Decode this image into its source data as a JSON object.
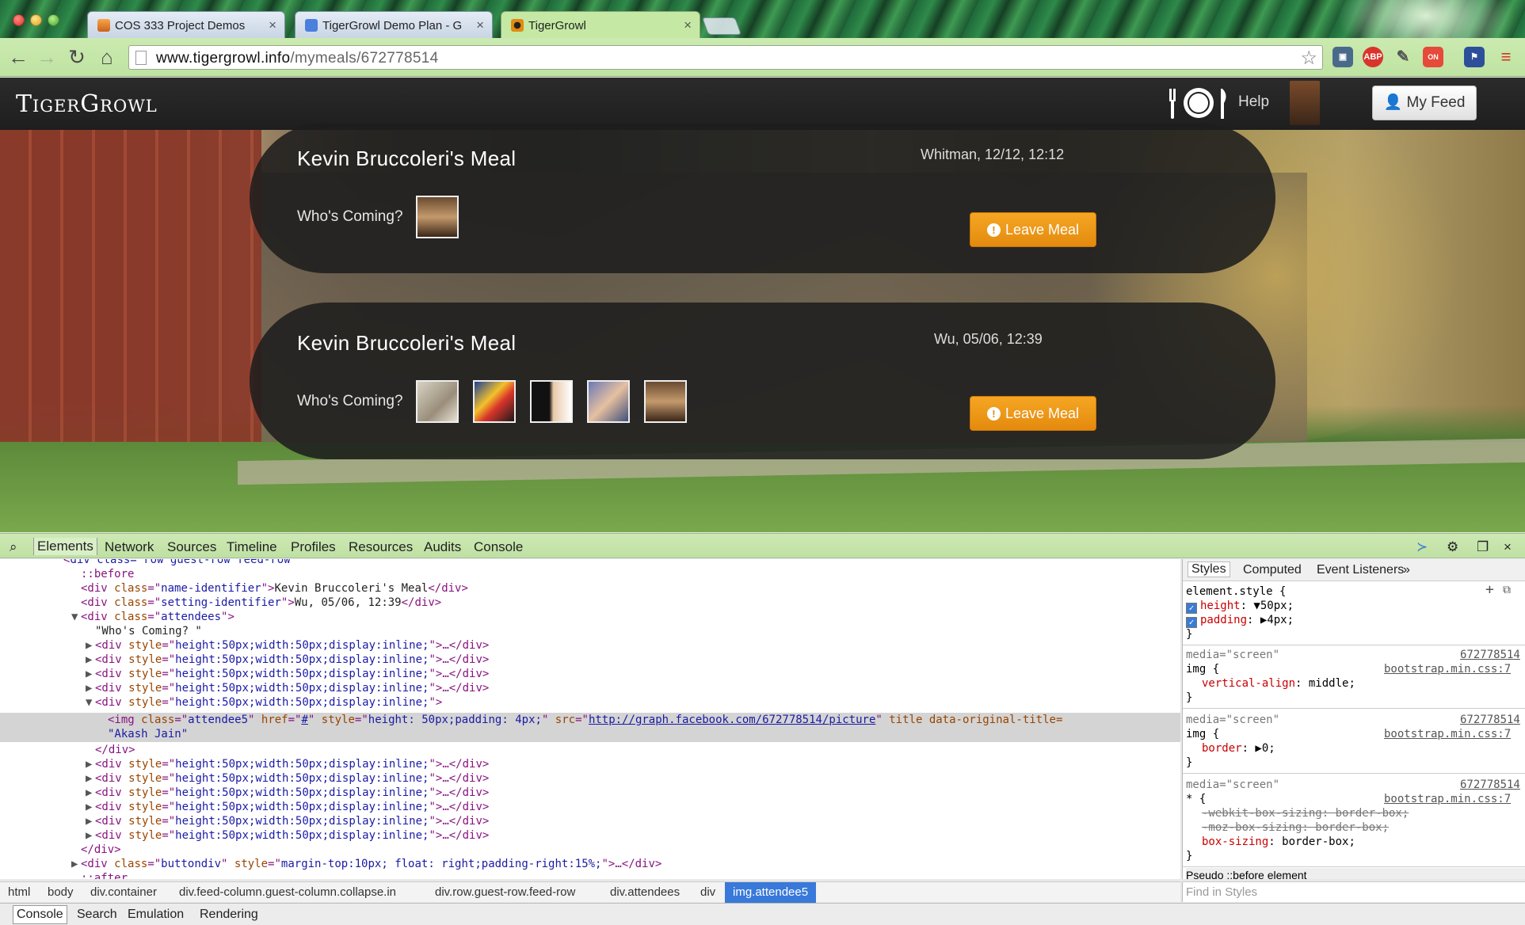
{
  "browser": {
    "tabs": [
      {
        "title": "COS 333 Project Demos",
        "favicon": "princeton-shield-icon"
      },
      {
        "title": "TigerGrowl Demo Plan - G",
        "favicon": "google-docs-icon"
      },
      {
        "title": "TigerGrowl",
        "favicon": "tigergrowl-paw-icon"
      }
    ],
    "url_domain": "www.tigergrowl.info",
    "url_path": "/mymeals/672778514"
  },
  "app": {
    "logo": "TigerGrowl",
    "help_label": "Help",
    "myfeed_label": "My Feed"
  },
  "meals": [
    {
      "title": "Kevin Bruccoleri's Meal",
      "setting": "Whitman, 12/12, 12:12",
      "who_label": "Who's Coming?",
      "attendee_count": 1,
      "leave_label": "Leave Meal"
    },
    {
      "title": "Kevin Bruccoleri's Meal",
      "setting": "Wu, 05/06, 12:39",
      "who_label": "Who's Coming?",
      "attendee_count": 5,
      "leave_label": "Leave Meal"
    }
  ],
  "devtools": {
    "tabs": [
      "Elements",
      "Network",
      "Sources",
      "Timeline",
      "Profiles",
      "Resources",
      "Audits",
      "Console"
    ],
    "dom": {
      "top_fragment": "div class=\"row guest-row feed-row",
      "before": "::before",
      "name_identifier_text": "Kevin Bruccoleri's Meal",
      "setting_identifier_text": "Wu, 05/06, 12:39",
      "whos_coming_text": "\"Who's Coming?          \"",
      "div_style": "height:50px;width:50px;display:inline;",
      "img_class": "attendee5",
      "img_href": "#",
      "img_style": "height: 50px;padding: 4px;",
      "img_src": "http://graph.facebook.com/672778514/picture",
      "img_title_attr": "title data-original-title=",
      "img_original_title": "\"Akash Jain\"",
      "buttondiv_style": "margin-top:10px; float: right;padding-right:15%;",
      "after": "::after"
    },
    "styles": {
      "tabs": [
        "Styles",
        "Computed",
        "Event Listeners"
      ],
      "element_style": "element.style {",
      "height_prop": "height",
      "height_val": "50px;",
      "padding_prop": "padding",
      "padding_val": "4px;",
      "media": "media=\"screen\"",
      "rule_ref": "672778514",
      "source": "bootstrap.min.css:7",
      "img_sel": "img {",
      "star_sel": "* {",
      "vertical_align_prop": "vertical-align",
      "vertical_align_val": "middle;",
      "border_prop": "border",
      "border_val": "0;",
      "webkit_bs": "-webkit-box-sizing: border-box;",
      "moz_bs": "-moz-box-sizing: border-box;",
      "box_sizing_prop": "box-sizing",
      "box_sizing_val": "border-box;",
      "pseudo": "Pseudo ::before element",
      "find_placeholder": "Find in Styles"
    },
    "breadcrumbs": [
      "html",
      "body",
      "div.container",
      "div.feed-column.guest-column.collapse.in",
      "div.row.guest-row.feed-row",
      "div.attendees",
      "div",
      "img.attendee5"
    ],
    "drawer_tabs": [
      "Console",
      "Search",
      "Emulation",
      "Rendering"
    ]
  },
  "colors": {
    "accent_orange": "#f5a623",
    "selection_blue": "#3879d9",
    "tag_purple": "#881280",
    "attr_brown": "#994500",
    "value_blue": "#1a1aa6"
  }
}
